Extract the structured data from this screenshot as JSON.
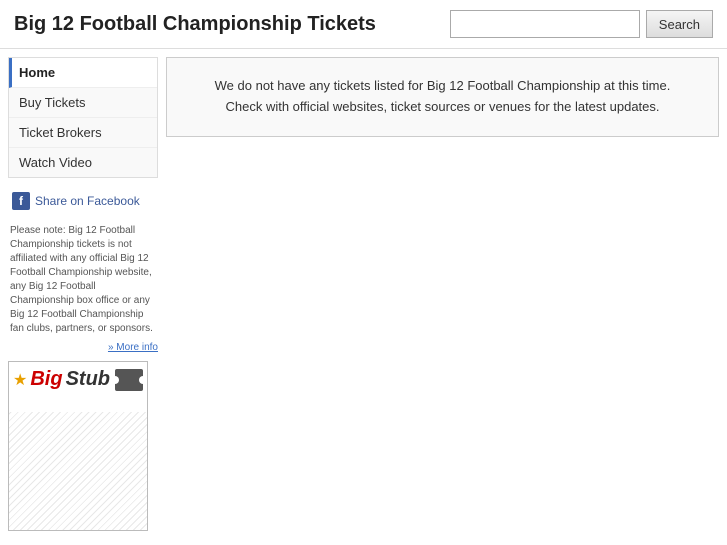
{
  "header": {
    "title": "Big 12 Football Championship Tickets",
    "search_placeholder": "",
    "search_label": "Search"
  },
  "sidebar": {
    "items": [
      {
        "label": "Home",
        "active": true
      },
      {
        "label": "Buy Tickets",
        "active": false
      },
      {
        "label": "Ticket Brokers",
        "active": false
      },
      {
        "label": "Watch Video",
        "active": false
      }
    ],
    "facebook_share": "Share on Facebook",
    "disclaimer": "Please note: Big 12 Football Championship tickets is not affiliated with any official Big 12 Football Championship website, any Big 12 Football Championship box office or any Big 12 Football Championship fan clubs, partners, or sponsors.",
    "more_info_label": "» More info"
  },
  "main": {
    "notice_line1": "We do not have any tickets listed for Big 12 Football Championship at this time.",
    "notice_line2": "Check with official websites, ticket sources or venues for the latest updates."
  },
  "bigstub": {
    "big_text": "Big",
    "stub_text": "Stub"
  }
}
